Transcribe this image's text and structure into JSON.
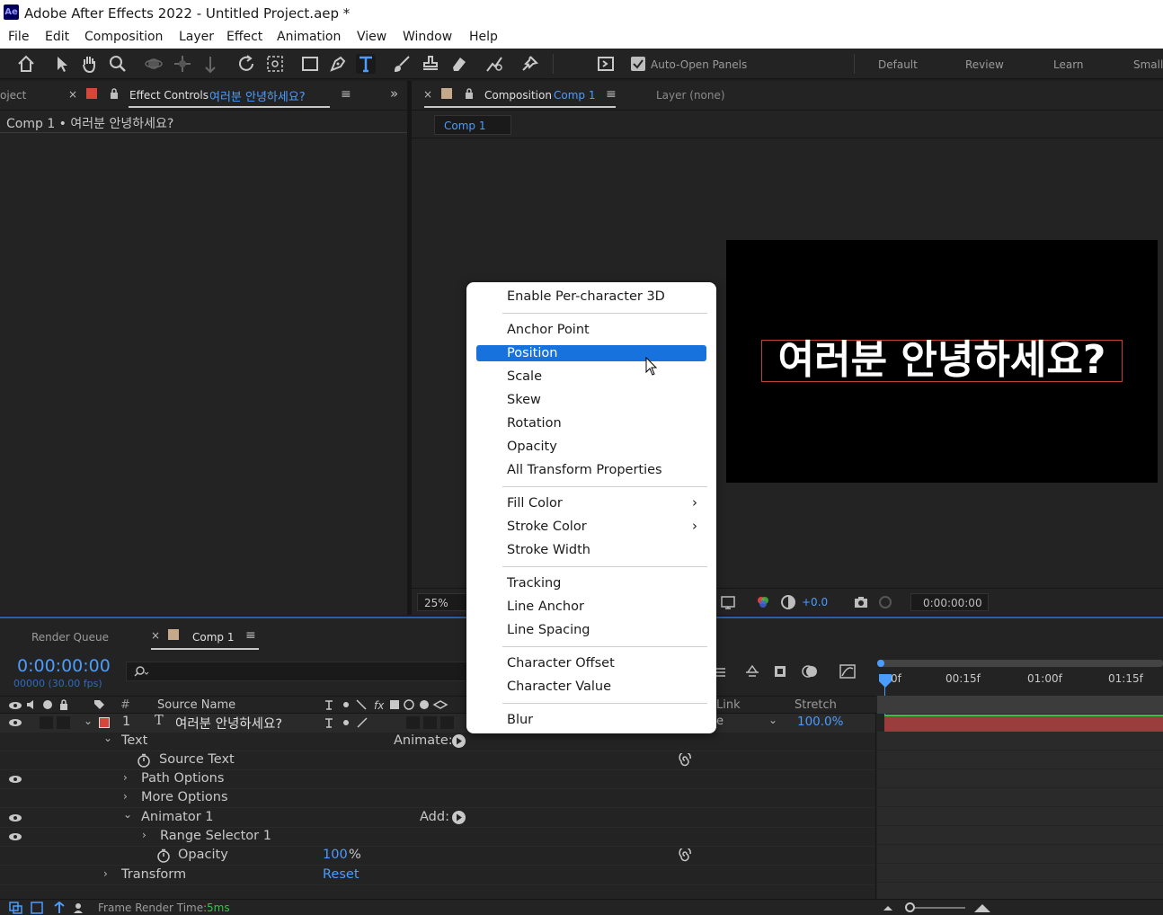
{
  "app": {
    "logo": "Ae",
    "title": "Adobe After Effects 2022 - Untitled Project.aep *",
    "colors": {
      "accent": "#4a9cff",
      "selection": "#1872dd",
      "layer_label": "#d6463b",
      "bar": "#9b3d3d"
    }
  },
  "menu": [
    "File",
    "Edit",
    "Composition",
    "Layer",
    "Effect",
    "Animation",
    "View",
    "Window",
    "Help"
  ],
  "toolbar": {
    "tools": [
      "home-icon",
      "selection-arrow-icon",
      "hand-icon",
      "zoom-icon",
      "orbit-camera-icon",
      "pan-camera-icon",
      "dolly-camera-icon",
      "rotate-icon",
      "anchor-point-icon",
      "rectangle-icon",
      "pen-icon",
      "type-icon",
      "brush-icon",
      "clone-stamp-icon",
      "eraser-icon",
      "roto-brush-icon",
      "puppet-pin-icon"
    ],
    "auto_open": "Auto-Open Panels",
    "workspaces": [
      "Default",
      "Review",
      "Learn",
      "Small"
    ]
  },
  "left_panel": {
    "project_tab": "oject",
    "tab_label": "Effect Controls",
    "tab_layer": "여러분 안녕하세요?",
    "breadcrumb": "Comp 1 • 여러분 안녕하세요?"
  },
  "comp_panel": {
    "tab_label": "Composition",
    "tab_comp": "Comp 1",
    "layer_tab": "Layer (none)",
    "sub_tab": "Comp 1",
    "viewer_text": "여러분 안녕하세요?",
    "zoom": "25%",
    "exposure": "+0.0",
    "timecode": "0:00:00:00"
  },
  "context_menu": {
    "groups": [
      [
        "Enable Per-character 3D"
      ],
      [
        "Anchor Point",
        "Position",
        "Scale",
        "Skew",
        "Rotation",
        "Opacity",
        "All Transform Properties"
      ],
      [
        "Fill Color",
        "Stroke Color",
        "Stroke Width"
      ],
      [
        "Tracking",
        "Line Anchor",
        "Line Spacing"
      ],
      [
        "Character Offset",
        "Character Value"
      ],
      [
        "Blur"
      ]
    ],
    "selected": "Position",
    "submenu_items": [
      "Fill Color",
      "Stroke Color"
    ]
  },
  "timeline": {
    "render_queue": "Render Queue",
    "comp_tab": "Comp 1",
    "timecode": "0:00:00:00",
    "fps": "00000 (30.00 fps)",
    "search_placeholder": "",
    "headers": {
      "num": "#",
      "source": "Source Name",
      "link": "Link",
      "stretch": "Stretch"
    },
    "ruler": [
      "0f",
      "00:15f",
      "01:00f",
      "01:15f"
    ],
    "layer": {
      "num": "1",
      "type": "T",
      "name": "여러분 안녕하세요?",
      "stretch": "100.0%",
      "parent": "e"
    },
    "rows": {
      "text": "Text",
      "animate": "Animate:",
      "source_text": "Source Text",
      "path_options": "Path Options",
      "more_options": "More Options",
      "animator": "Animator 1",
      "add": "Add:",
      "range_selector": "Range Selector 1",
      "opacity": "Opacity",
      "opacity_value": "100",
      "opacity_unit": "%",
      "transform": "Transform",
      "reset": "Reset"
    },
    "frame_render_label": "Frame Render Time:",
    "frame_render_value": "5ms"
  }
}
